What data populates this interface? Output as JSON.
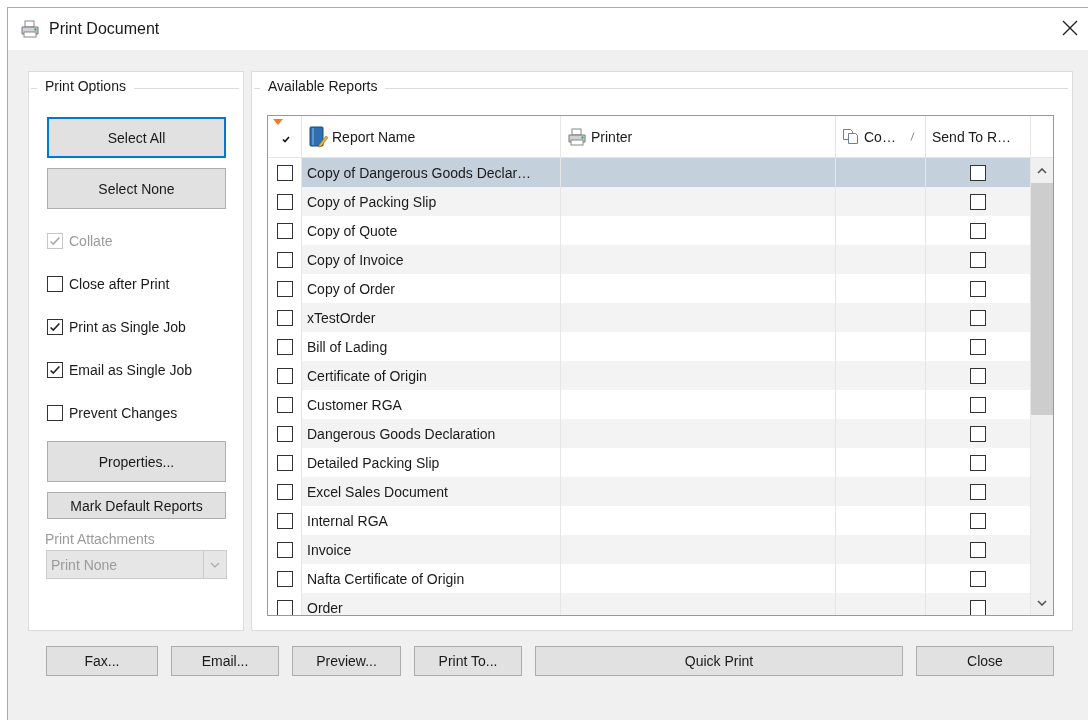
{
  "window": {
    "title": "Print Document"
  },
  "print_options": {
    "title": "Print Options",
    "buttons": [
      {
        "label": "Select All",
        "focused": true
      },
      {
        "label": "Select None",
        "focused": false
      }
    ],
    "checkboxes": [
      {
        "label": "Collate",
        "checked": true,
        "disabled": true
      },
      {
        "label": "Close after Print",
        "checked": false,
        "disabled": false
      },
      {
        "label": "Print as Single Job",
        "checked": true,
        "disabled": false
      },
      {
        "label": "Email as Single Job",
        "checked": true,
        "disabled": false
      },
      {
        "label": "Prevent Changes",
        "checked": false,
        "disabled": false
      }
    ],
    "properties_button": "Properties...",
    "mark_default_button": "Mark Default Reports",
    "attachments": {
      "label": "Print Attachments",
      "value": "Print None",
      "disabled": true
    }
  },
  "available_reports": {
    "title": "Available Reports",
    "columns": [
      {
        "kind": "check"
      },
      {
        "kind": "book",
        "label": "Report Name"
      },
      {
        "kind": "printer",
        "label": "Printer"
      },
      {
        "kind": "copies",
        "label": "Co…"
      },
      {
        "kind": "text",
        "label": "Send To R…"
      }
    ],
    "rows": [
      {
        "name": "Copy of Dangerous Goods Declar…",
        "checked": false,
        "send": false,
        "selected": true
      },
      {
        "name": "Copy of Packing Slip",
        "checked": false,
        "send": false,
        "selected": false
      },
      {
        "name": "Copy of Quote",
        "checked": false,
        "send": false,
        "selected": false
      },
      {
        "name": "Copy of Invoice",
        "checked": false,
        "send": false,
        "selected": false
      },
      {
        "name": "Copy of Order",
        "checked": false,
        "send": false,
        "selected": false
      },
      {
        "name": "xTestOrder",
        "checked": false,
        "send": false,
        "selected": false
      },
      {
        "name": "Bill of Lading",
        "checked": false,
        "send": false,
        "selected": false
      },
      {
        "name": "Certificate of Origin",
        "checked": false,
        "send": false,
        "selected": false
      },
      {
        "name": "Customer RGA",
        "checked": false,
        "send": false,
        "selected": false
      },
      {
        "name": "Dangerous Goods Declaration",
        "checked": false,
        "send": false,
        "selected": false
      },
      {
        "name": "Detailed Packing Slip",
        "checked": false,
        "send": false,
        "selected": false
      },
      {
        "name": "Excel Sales Document",
        "checked": false,
        "send": false,
        "selected": false
      },
      {
        "name": "Internal RGA",
        "checked": false,
        "send": false,
        "selected": false
      },
      {
        "name": "Invoice",
        "checked": false,
        "send": false,
        "selected": false
      },
      {
        "name": "Nafta Certificate of Origin",
        "checked": false,
        "send": false,
        "selected": false
      },
      {
        "name": "Order",
        "checked": false,
        "send": false,
        "selected": false
      }
    ]
  },
  "bottom_buttons": [
    "Fax...",
    "Email...",
    "Preview...",
    "Print To...",
    "Quick Print",
    "Close"
  ]
}
